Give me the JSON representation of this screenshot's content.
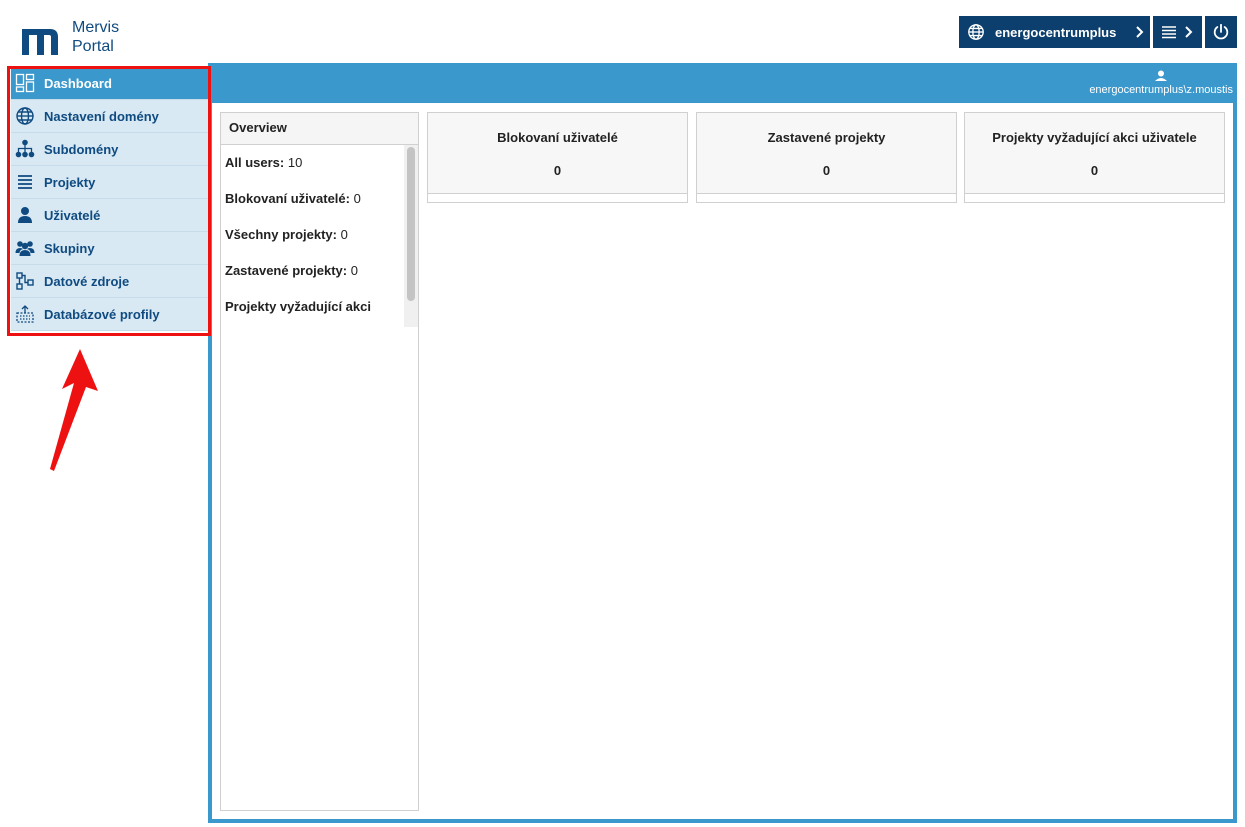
{
  "header": {
    "logo_line1": "Mervis",
    "logo_line2": "Portal",
    "domain_label": "energocentrumplus"
  },
  "sidebar": {
    "items": [
      {
        "label": "Dashboard",
        "icon": "dashboard-icon",
        "active": true
      },
      {
        "label": "Nastavení domény",
        "icon": "globe-icon"
      },
      {
        "label": "Subdomény",
        "icon": "hierarchy-icon"
      },
      {
        "label": "Projekty",
        "icon": "list-icon"
      },
      {
        "label": "Uživatelé",
        "icon": "user-icon"
      },
      {
        "label": "Skupiny",
        "icon": "users-group-icon"
      },
      {
        "label": "Datové zdroje",
        "icon": "data-source-icon"
      },
      {
        "label": "Databázové profily",
        "icon": "database-icon"
      }
    ]
  },
  "main": {
    "user": "energocentrumplus\\z.moustis"
  },
  "overview": {
    "title": "Overview",
    "rows": [
      {
        "label": "All users:",
        "value": "10"
      },
      {
        "label": "Blokovaní uživatelé:",
        "value": "0"
      },
      {
        "label": "Všechny projekty:",
        "value": "0"
      },
      {
        "label": "Zastavené projekty:",
        "value": "0"
      },
      {
        "label": "Projekty vyžadující akci",
        "value": ""
      }
    ]
  },
  "cards": [
    {
      "title": "Blokovaní uživatelé",
      "value": "0"
    },
    {
      "title": "Zastavené projekty",
      "value": "0"
    },
    {
      "title": "Projekty vyžadující akci uživatele",
      "value": "0"
    }
  ],
  "colors": {
    "primary": "#3a98cc",
    "dark": "#0c3f6e",
    "nav_bg": "#d8e9f3",
    "highlight": "#ee1111"
  }
}
